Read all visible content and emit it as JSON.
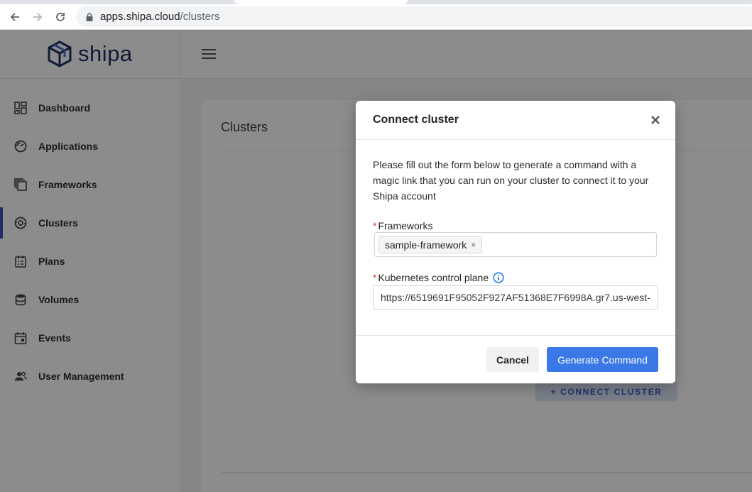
{
  "browser": {
    "url_host": "apps.shipa.cloud",
    "url_path": "/clusters",
    "icons": [
      "back-arrow-icon",
      "forward-arrow-icon",
      "reload-icon",
      "lock-icon"
    ]
  },
  "app": {
    "brand": "shipa",
    "colors": {
      "accent": "#3f51b5",
      "primary_button": "#3b78e7",
      "brand": "#1e3163"
    }
  },
  "sidebar": {
    "items": [
      {
        "label": "Dashboard",
        "icon": "dashboard-icon",
        "active": false
      },
      {
        "label": "Applications",
        "icon": "applications-icon",
        "active": false
      },
      {
        "label": "Frameworks",
        "icon": "frameworks-icon",
        "active": false
      },
      {
        "label": "Clusters",
        "icon": "clusters-icon",
        "active": true
      },
      {
        "label": "Plans",
        "icon": "plans-icon",
        "active": false
      },
      {
        "label": "Volumes",
        "icon": "volumes-icon",
        "active": false
      },
      {
        "label": "Events",
        "icon": "events-icon",
        "active": false
      },
      {
        "label": "User Management",
        "icon": "users-icon",
        "active": false
      }
    ]
  },
  "main": {
    "title": "Clusters",
    "connect_button": "+ CONNECT CLUSTER"
  },
  "modal": {
    "title": "Connect cluster",
    "description": "Please fill out the form below to generate a command with a magic link that you can run on your cluster to connect it to your Shipa account",
    "frameworks_label": "Frameworks",
    "frameworks_selected": "sample-framework",
    "control_plane_label": "Kubernetes control plane",
    "control_plane_value": "https://6519691F95052F927AF51368E7F6998A.gr7.us-west-",
    "required_mark": "*",
    "cancel_label": "Cancel",
    "generate_label": "Generate Command"
  }
}
